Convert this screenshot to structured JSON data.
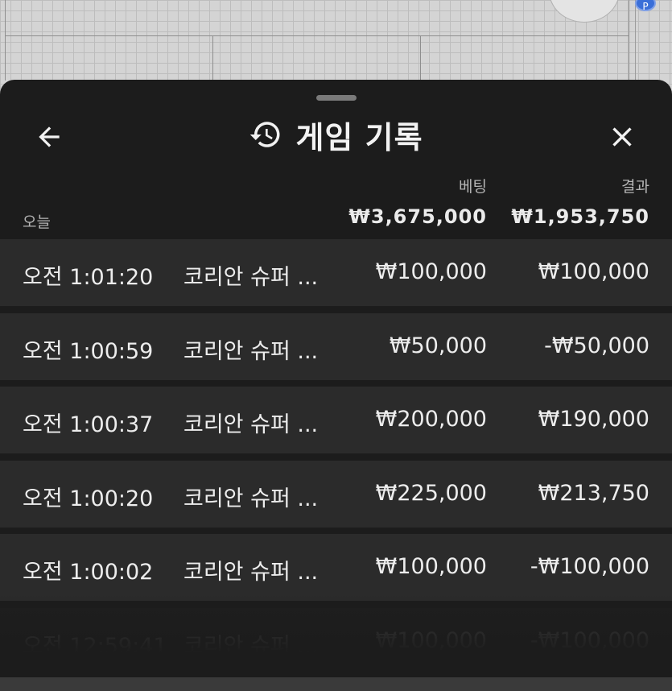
{
  "header": {
    "title": "게임 기록",
    "back_icon": "arrow-left-icon",
    "history_icon": "history-icon",
    "close_icon": "close-icon"
  },
  "summary": {
    "period_label": "오늘",
    "bet_header": "베팅",
    "result_header": "결과",
    "total_bet": "₩3,675,000",
    "total_result": "₩1,953,750"
  },
  "rows": [
    {
      "time": "오전 1:01:20",
      "game": "코리안 슈퍼 ...",
      "bet": "₩100,000",
      "result": "₩100,000"
    },
    {
      "time": "오전 1:00:59",
      "game": "코리안 슈퍼 ...",
      "bet": "₩50,000",
      "result": "-₩50,000"
    },
    {
      "time": "오전 1:00:37",
      "game": "코리안 슈퍼 ...",
      "bet": "₩200,000",
      "result": "₩190,000"
    },
    {
      "time": "오전 1:00:20",
      "game": "코리안 슈퍼 ...",
      "bet": "₩225,000",
      "result": "₩213,750"
    },
    {
      "time": "오전 1:00:02",
      "game": "코리안 슈퍼 ...",
      "bet": "₩100,000",
      "result": "-₩100,000"
    },
    {
      "time": "오전 12:59:41",
      "game": "코리안 슈퍼 ...",
      "bet": "₩100,000",
      "result": "-₩100,000"
    }
  ],
  "background": {
    "badge_label": "P"
  },
  "colors": {
    "sheet_bg": "#1c1c1c",
    "row_bg": "#2b2b2b",
    "text": "#ededed",
    "muted": "#b5b5b5"
  }
}
